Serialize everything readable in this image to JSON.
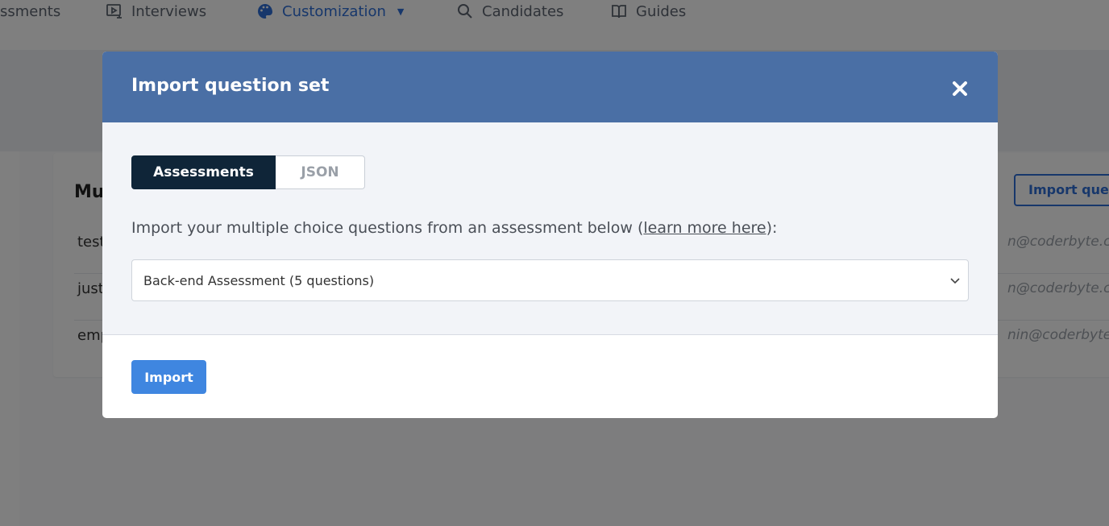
{
  "nav": {
    "items": [
      {
        "label": "ssments",
        "icon": "assessments-icon"
      },
      {
        "label": "Interviews",
        "icon": "interviews-icon"
      },
      {
        "label": "Customization",
        "icon": "palette-icon"
      },
      {
        "label": "Candidates",
        "icon": "search-icon"
      },
      {
        "label": "Guides",
        "icon": "book-icon"
      }
    ],
    "active_color": "#2f6fd6"
  },
  "background": {
    "card_title": "Mu",
    "card_button": "Import ques",
    "rows": [
      {
        "name": "test",
        "email": "n@coderbyte.com"
      },
      {
        "name": "just",
        "email": "n@coderbyte.com"
      },
      {
        "name": "emp",
        "email": "nin@coderbyte.com"
      }
    ]
  },
  "modal": {
    "title": "Import question set",
    "close_icon": "close-icon",
    "header_color": "#4a6fa5",
    "tabs": [
      {
        "label": "Assessments",
        "active": true
      },
      {
        "label": "JSON",
        "active": false
      }
    ],
    "instruction_prefix": "Import your multiple choice questions from an assessment below (",
    "instruction_link": "learn more here",
    "instruction_suffix": "):",
    "select_value": "Back-end Assessment (5 questions)",
    "import_label": "Import",
    "import_color": "#3f86e0"
  }
}
